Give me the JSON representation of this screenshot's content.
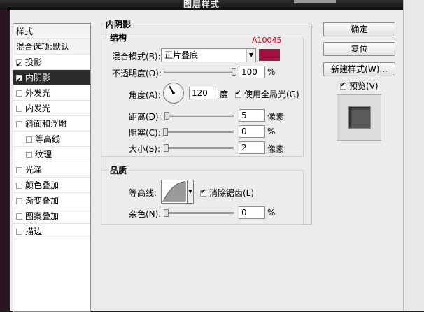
{
  "window": {
    "title": "图层样式"
  },
  "styles_list": {
    "header": "样式",
    "blend_options": "混合选项:默认",
    "items": [
      {
        "label": "投影",
        "checked": true,
        "selected": false,
        "indent": false
      },
      {
        "label": "内阴影",
        "checked": true,
        "selected": true,
        "indent": false
      },
      {
        "label": "外发光",
        "checked": false,
        "selected": false,
        "indent": false
      },
      {
        "label": "内发光",
        "checked": false,
        "selected": false,
        "indent": false
      },
      {
        "label": "斜面和浮雕",
        "checked": false,
        "selected": false,
        "indent": false
      },
      {
        "label": "等高线",
        "checked": false,
        "selected": false,
        "indent": true
      },
      {
        "label": "纹理",
        "checked": false,
        "selected": false,
        "indent": true
      },
      {
        "label": "光泽",
        "checked": false,
        "selected": false,
        "indent": false
      },
      {
        "label": "颜色叠加",
        "checked": false,
        "selected": false,
        "indent": false
      },
      {
        "label": "渐变叠加",
        "checked": false,
        "selected": false,
        "indent": false
      },
      {
        "label": "图案叠加",
        "checked": false,
        "selected": false,
        "indent": false
      },
      {
        "label": "描边",
        "checked": false,
        "selected": false,
        "indent": false
      }
    ]
  },
  "panel": {
    "title": "内阴影",
    "structure": {
      "legend": "结构",
      "color_tag": "A10045",
      "color_hex": "#a3103f",
      "blend_mode_label": "混合模式(B):",
      "blend_mode_value": "正片叠底",
      "opacity_label": "不透明度(O):",
      "opacity_value": "100",
      "opacity_unit": "%",
      "opacity_level": 1.0,
      "angle_label": "角度(A):",
      "angle_value": "120",
      "angle_unit": "度",
      "global_light_label": "使用全局光(G)",
      "global_light_checked": true,
      "distance_label": "距离(D):",
      "distance_value": "5",
      "distance_unit": "像素",
      "choke_label": "阻塞(C):",
      "choke_value": "0",
      "choke_unit": "%",
      "size_label": "大小(S):",
      "size_value": "2",
      "size_unit": "像素"
    },
    "quality": {
      "legend": "品质",
      "contour_label": "等高线:",
      "antialias_label": "消除锯齿(L)",
      "antialias_checked": true,
      "noise_label": "杂色(N):",
      "noise_value": "0",
      "noise_unit": "%"
    }
  },
  "buttons": {
    "ok": "确定",
    "reset": "复位",
    "new_style": "新建样式(W)...",
    "preview_label": "预览(V)",
    "preview_checked": true
  }
}
